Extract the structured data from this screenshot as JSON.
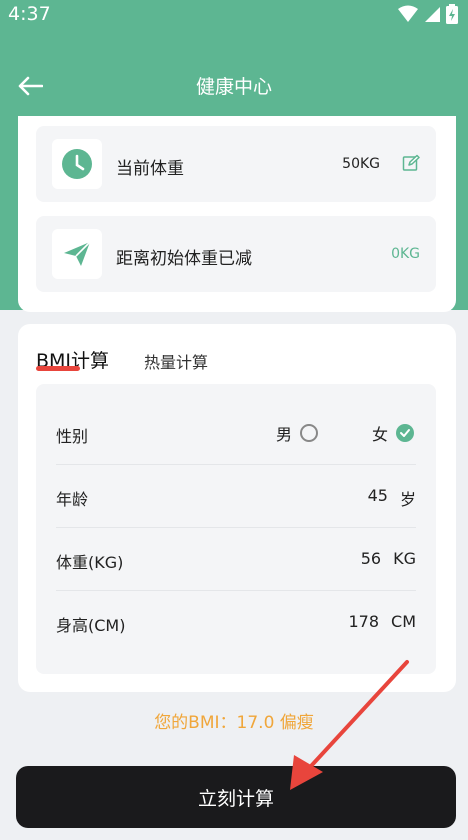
{
  "status_bar": {
    "time": "4:37"
  },
  "app_bar": {
    "title": "健康中心"
  },
  "weight_card": {
    "current_weight_label": "当前体重",
    "current_weight_value": "50KG",
    "lost_label": "距离初始体重已减",
    "lost_value": "0KG"
  },
  "tabs": {
    "bmi": "BMI计算",
    "heat": "热量计算"
  },
  "form": {
    "gender_label": "性别",
    "male": "男",
    "female": "女",
    "age_label": "年龄",
    "age_value": "45",
    "age_unit": "岁",
    "weight_label": "体重(KG)",
    "weight_value": "56",
    "weight_unit": "KG",
    "height_label": "身高(CM)",
    "height_value": "178",
    "height_unit": "CM"
  },
  "result": "您的BMI：17.0 偏瘦",
  "calc_button": "立刻计算",
  "colors": {
    "primary": "#5db692",
    "accent": "#f0a63a",
    "annotation": "#e8453c"
  }
}
